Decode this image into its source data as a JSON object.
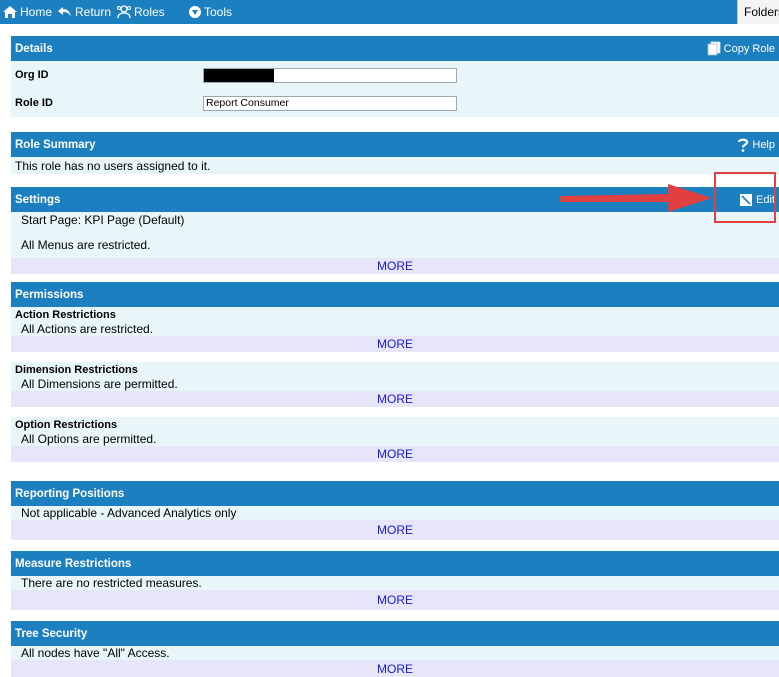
{
  "toolbar": {
    "home": "Home",
    "return": "Return",
    "roles": "Roles",
    "tools": "Tools",
    "folders": "Folders"
  },
  "details": {
    "title": "Details",
    "copy_role": "Copy Role",
    "org_id_label": "Org ID",
    "org_id_value": "",
    "role_id_label": "Role ID",
    "role_id_value": "Report Consumer"
  },
  "role_summary": {
    "title": "Role Summary",
    "help": "Help",
    "text": "This role has no users assigned to it."
  },
  "settings": {
    "title": "Settings",
    "edit": "Edit",
    "start_page": "Start Page: KPI Page (Default)",
    "menus": "All Menus are restricted.",
    "more": "MORE"
  },
  "permissions": {
    "title": "Permissions",
    "action_title": "Action Restrictions",
    "action_text": "All Actions are restricted.",
    "dimension_title": "Dimension Restrictions",
    "dimension_text": "All Dimensions are permitted.",
    "option_title": "Option Restrictions",
    "option_text": "All Options are permitted.",
    "more": "MORE"
  },
  "reporting_positions": {
    "title": "Reporting Positions",
    "text": "Not applicable - Advanced Analytics only",
    "more": "MORE"
  },
  "measure_restrictions": {
    "title": "Measure Restrictions",
    "text": "There are no restricted measures.",
    "more": "MORE"
  },
  "tree_security": {
    "title": "Tree Security",
    "text": "All nodes have \"All\" Access.",
    "more": "MORE"
  },
  "colors": {
    "header_blue": "#1b7fc0",
    "light_blue": "#e8f6fa",
    "more_lavender": "#e6e6f8",
    "more_link": "#1a1acc",
    "highlight_red": "#e04040"
  }
}
